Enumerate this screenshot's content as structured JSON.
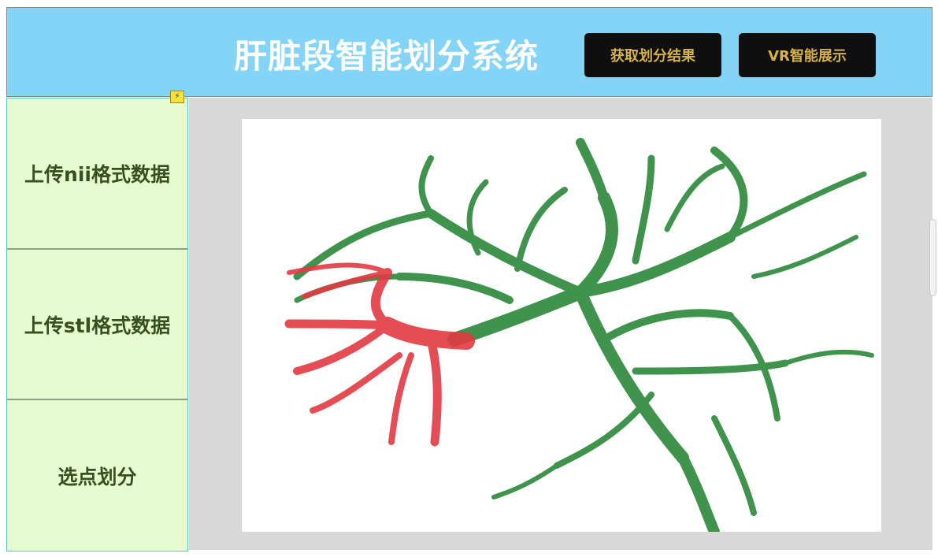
{
  "header": {
    "title": "肝脏段智能划分系统",
    "buttons": [
      {
        "label": "获取划分结果"
      },
      {
        "label": "VR智能展示"
      }
    ]
  },
  "sidebar": {
    "items": [
      {
        "label": "上传nii格式数据"
      },
      {
        "label": "上传stl格式数据"
      },
      {
        "label": "选点划分"
      }
    ]
  },
  "viewer": {
    "model_colors": {
      "vessels": "#2f8a3e",
      "selected_segment": "#e23a42"
    }
  },
  "colors": {
    "header_bg": "#84d4f8",
    "button_bg": "#0f0f0f",
    "button_text": "#d7b14a",
    "sidebar_bg": "#e6fbd0",
    "sidebar_text": "#3b4e22",
    "main_bg": "#d8d8d8"
  }
}
